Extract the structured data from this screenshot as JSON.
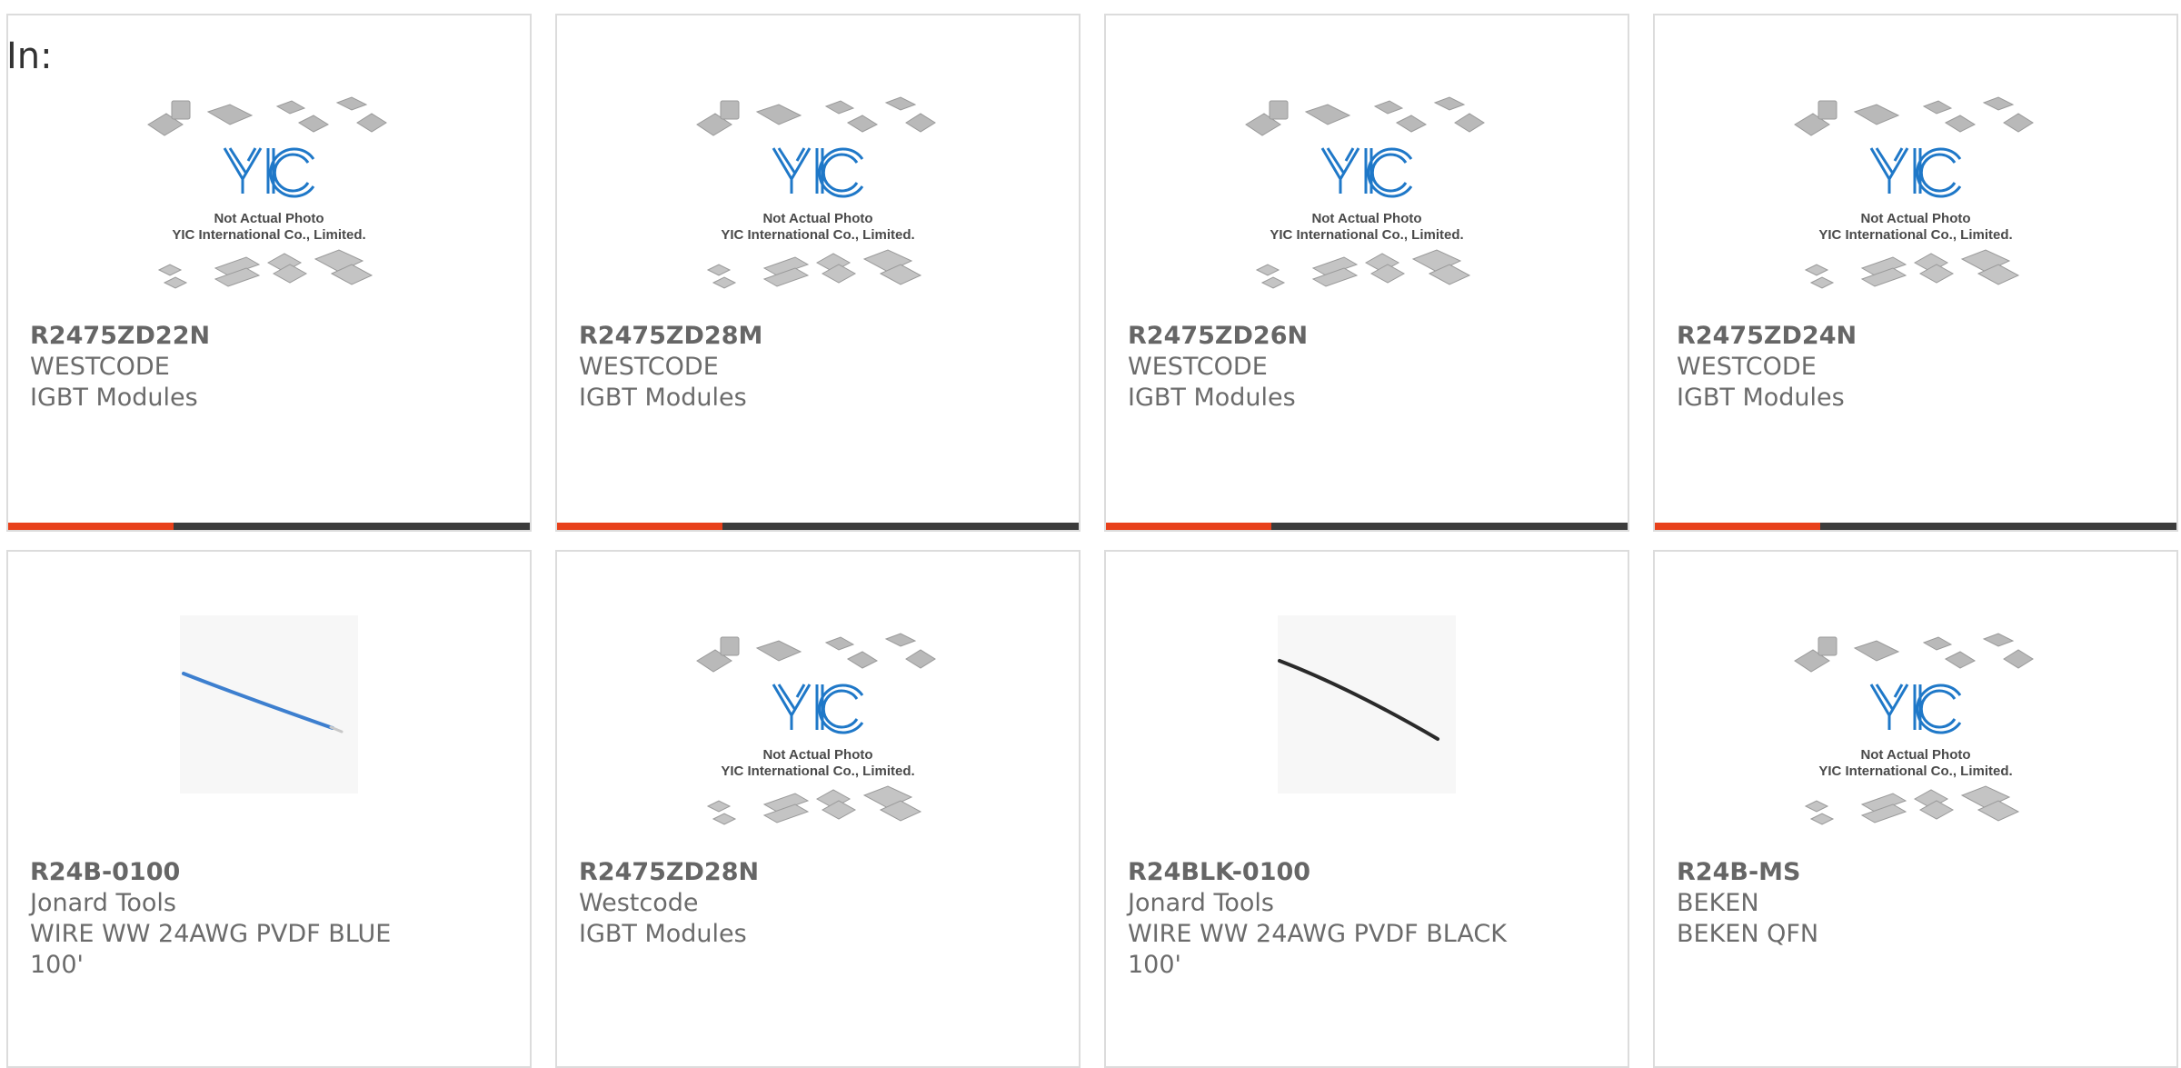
{
  "header": {
    "label": "In:"
  },
  "colors": {
    "accent": "#e8411b",
    "bar": "#3c3c3c",
    "text": "#6b6b6b",
    "border": "#dcdcdc"
  },
  "products": [
    {
      "part_number": "R2475ZD22N",
      "manufacturer": "WESTCODE",
      "description": "IGBT Modules",
      "image": "placeholder-photo",
      "watermark": {
        "line1": "Not Actual Photo",
        "line2": "YIC International Co., Limited."
      }
    },
    {
      "part_number": "R2475ZD28M",
      "manufacturer": "WESTCODE",
      "description": "IGBT Modules",
      "image": "placeholder-photo",
      "watermark": {
        "line1": "Not Actual Photo",
        "line2": "YIC International Co., Limited."
      }
    },
    {
      "part_number": "R2475ZD26N",
      "manufacturer": "WESTCODE",
      "description": "IGBT Modules",
      "image": "placeholder-photo",
      "watermark": {
        "line1": "Not Actual Photo",
        "line2": "YIC International Co., Limited."
      }
    },
    {
      "part_number": "R2475ZD24N",
      "manufacturer": "WESTCODE",
      "description": "IGBT Modules",
      "image": "placeholder-photo",
      "watermark": {
        "line1": "Not Actual Photo",
        "line2": "YIC International Co., Limited."
      }
    },
    {
      "part_number": "R24B-0100",
      "manufacturer": "Jonard Tools",
      "description": "WIRE WW 24AWG PVDF BLUE 100'",
      "image": "wire-blue",
      "wire_color": "#3d7fcf"
    },
    {
      "part_number": "R2475ZD28N",
      "manufacturer": "Westcode",
      "description": "IGBT Modules",
      "image": "placeholder-photo",
      "watermark": {
        "line1": "Not Actual Photo",
        "line2": "YIC International Co., Limited."
      }
    },
    {
      "part_number": "R24BLK-0100",
      "manufacturer": "Jonard Tools",
      "description": "WIRE WW 24AWG PVDF BLACK 100'",
      "image": "wire-black",
      "wire_color": "#2a2a2a"
    },
    {
      "part_number": "R24B-MS",
      "manufacturer": "BEKEN",
      "description": "BEKEN QFN",
      "image": "placeholder-photo",
      "watermark": {
        "line1": "Not Actual Photo",
        "line2": "YIC International Co., Limited."
      }
    }
  ]
}
